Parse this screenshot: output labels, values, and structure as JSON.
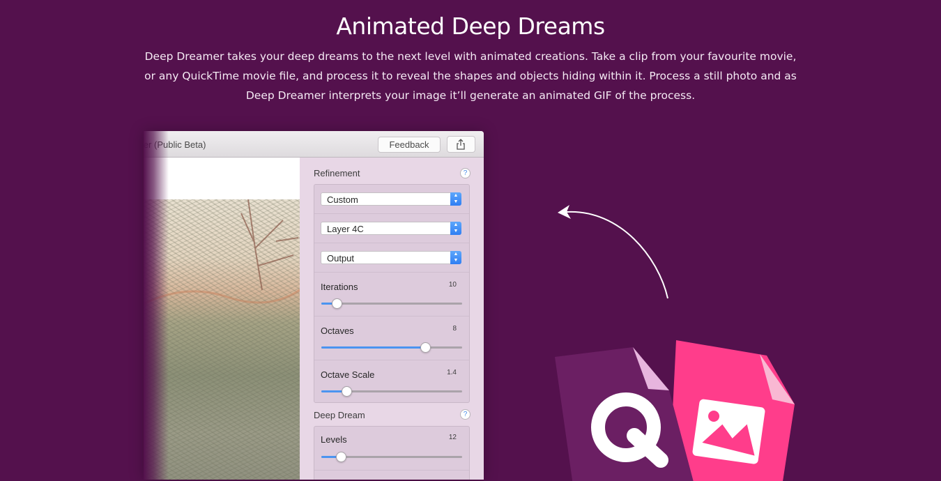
{
  "hero": {
    "title": "Animated Deep Dreams",
    "description": "Deep Dreamer takes your deep dreams to the next level with animated creations. Take a clip from your favourite movie, or any QuickTime movie file, and process it to reveal the shapes and objects hiding within it. Process a still photo and as Deep Dreamer interprets your image it’ll generate an animated GIF of the process."
  },
  "app": {
    "window_title": "mer (Public Beta)",
    "feedback_label": "Feedback",
    "share_icon": "share-icon",
    "refinement": {
      "title": "Refinement",
      "help": "?",
      "selects": [
        "Custom",
        "Layer 4C",
        "Output"
      ],
      "sliders": [
        {
          "label": "Iterations",
          "value": "10",
          "level": 0.11
        },
        {
          "label": "Octaves",
          "value": "8",
          "level": 0.74
        },
        {
          "label": "Octave Scale",
          "value": "1.4",
          "level": 0.18
        }
      ]
    },
    "deep_dream": {
      "title": "Deep Dream",
      "help": "?",
      "sliders": [
        {
          "label": "Levels",
          "value": "12",
          "level": 0.14
        }
      ]
    }
  },
  "colors": {
    "background": "#54114d",
    "accent_blue": "#4b94f0",
    "quicktime_purple": "#6b1f63",
    "image_pink": "#ff3d8b"
  },
  "icons": [
    "share-icon",
    "help-icon",
    "curved-arrow-icon",
    "quicktime-file-icon",
    "image-file-icon"
  ]
}
